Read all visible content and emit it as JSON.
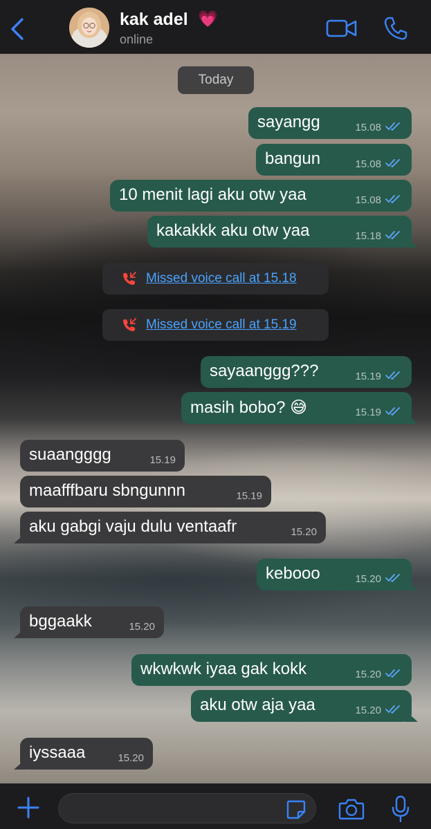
{
  "header": {
    "contact_name": "kak adel",
    "contact_emoji": "💗",
    "status": "online",
    "back_icon": "chevron-left-icon",
    "video_icon": "video-camera-icon",
    "call_icon": "phone-icon",
    "accent_color": "#3b82f6"
  },
  "chat": {
    "date_label": "Today",
    "bubble_out_color": "#275a4b",
    "bubble_in_color": "#3a3a3c",
    "messages": [
      {
        "type": "out",
        "text": "sayangg",
        "time": "15.08",
        "read": true
      },
      {
        "type": "out",
        "text": "bangun",
        "time": "15.08",
        "read": true
      },
      {
        "type": "out",
        "text": "10 menit lagi aku otw yaa",
        "time": "15.08",
        "read": true
      },
      {
        "type": "out",
        "text": "kakakkk aku otw yaa",
        "time": "15.18",
        "read": true
      },
      {
        "type": "missed",
        "text": "Missed voice call at 15.18",
        "icon": "missed-call-icon"
      },
      {
        "type": "missed",
        "text": "Missed voice call at 15.19",
        "icon": "missed-call-icon"
      },
      {
        "type": "out",
        "text": "sayaanggg???",
        "time": "15.19",
        "read": true
      },
      {
        "type": "out",
        "text": "masih bobo? 😅",
        "time": "15.19",
        "read": true
      },
      {
        "type": "in",
        "text": "suaangggg",
        "time": "15.19"
      },
      {
        "type": "in",
        "text": "maafffbaru sbngunnn",
        "time": "15.19"
      },
      {
        "type": "in",
        "text": "aku gabgi vaju dulu ventaafr",
        "time": "15.20"
      },
      {
        "type": "out",
        "text": "kebooo",
        "time": "15.20",
        "read": true
      },
      {
        "type": "in",
        "text": "bggaakk",
        "time": "15.20"
      },
      {
        "type": "out",
        "text": "wkwkwk iyaa gak kokk",
        "time": "15.20",
        "read": true
      },
      {
        "type": "out",
        "text": "aku otw aja yaa",
        "time": "15.20",
        "read": true
      },
      {
        "type": "in",
        "text": "iyssaaa",
        "time": "15.20"
      }
    ]
  },
  "composer": {
    "input_value": "",
    "plus_icon": "plus-icon",
    "sticker_icon": "sticker-icon",
    "camera_icon": "camera-icon",
    "mic_icon": "microphone-icon"
  }
}
